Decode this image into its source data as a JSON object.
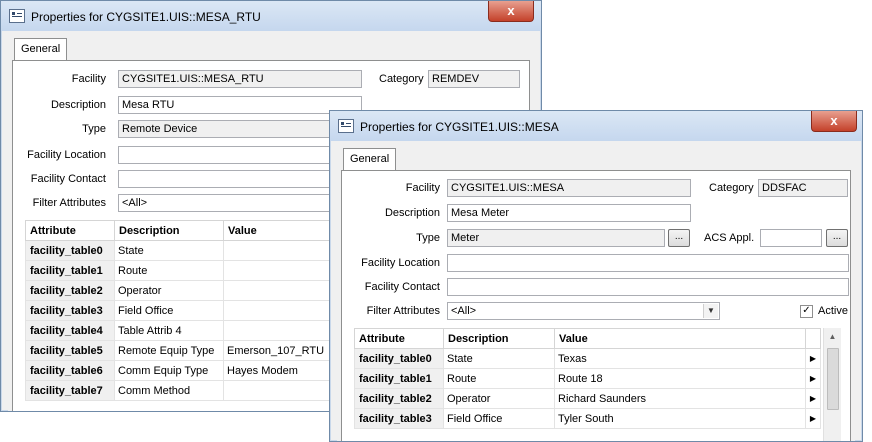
{
  "rtu_window": {
    "title": "Properties for CYGSITE1.UIS::MESA_RTU",
    "close_label": "x",
    "tab": "General",
    "labels": {
      "facility": "Facility",
      "category": "Category",
      "description": "Description",
      "type": "Type",
      "facility_location": "Facility Location",
      "facility_contact": "Facility Contact",
      "filter_attributes": "Filter Attributes"
    },
    "values": {
      "facility": "CYGSITE1.UIS::MESA_RTU",
      "category": "REMDEV",
      "description": "Mesa RTU",
      "type": "Remote Device",
      "facility_location": "",
      "facility_contact": "",
      "filter_attributes": "<All>"
    },
    "table": {
      "headers": [
        "Attribute",
        "Description",
        "Value"
      ],
      "rows": [
        {
          "attribute": "facility_table0",
          "description": "State",
          "value": ""
        },
        {
          "attribute": "facility_table1",
          "description": "Route",
          "value": ""
        },
        {
          "attribute": "facility_table2",
          "description": "Operator",
          "value": ""
        },
        {
          "attribute": "facility_table3",
          "description": "Field Office",
          "value": ""
        },
        {
          "attribute": "facility_table4",
          "description": "Table Attrib 4",
          "value": ""
        },
        {
          "attribute": "facility_table5",
          "description": "Remote Equip Type",
          "value": "Emerson_107_RTU"
        },
        {
          "attribute": "facility_table6",
          "description": "Comm Equip Type",
          "value": "Hayes Modem"
        },
        {
          "attribute": "facility_table7",
          "description": "Comm Method",
          "value": ""
        }
      ]
    }
  },
  "mesa_window": {
    "title": "Properties for CYGSITE1.UIS::MESA",
    "close_label": "x",
    "tab": "General",
    "labels": {
      "facility": "Facility",
      "category": "Category",
      "description": "Description",
      "type": "Type",
      "acs_appl": "ACS Appl.",
      "facility_location": "Facility Location",
      "facility_contact": "Facility Contact",
      "filter_attributes": "Filter Attributes",
      "active": "Active"
    },
    "values": {
      "facility": "CYGSITE1.UIS::MESA",
      "category": "DDSFAC",
      "description": "Mesa Meter",
      "type": "Meter",
      "acs_appl": "",
      "facility_location": "",
      "facility_contact": "",
      "filter_attributes": "<All>",
      "browse_label": "...",
      "active_checked": "✓"
    },
    "table": {
      "headers": [
        "Attribute",
        "Description",
        "Value"
      ],
      "rows": [
        {
          "attribute": "facility_table0",
          "description": "State",
          "value": "Texas"
        },
        {
          "attribute": "facility_table1",
          "description": "Route",
          "value": "Route 18"
        },
        {
          "attribute": "facility_table2",
          "description": "Operator",
          "value": "Richard Saunders"
        },
        {
          "attribute": "facility_table3",
          "description": "Field Office",
          "value": "Tyler South"
        }
      ]
    }
  }
}
